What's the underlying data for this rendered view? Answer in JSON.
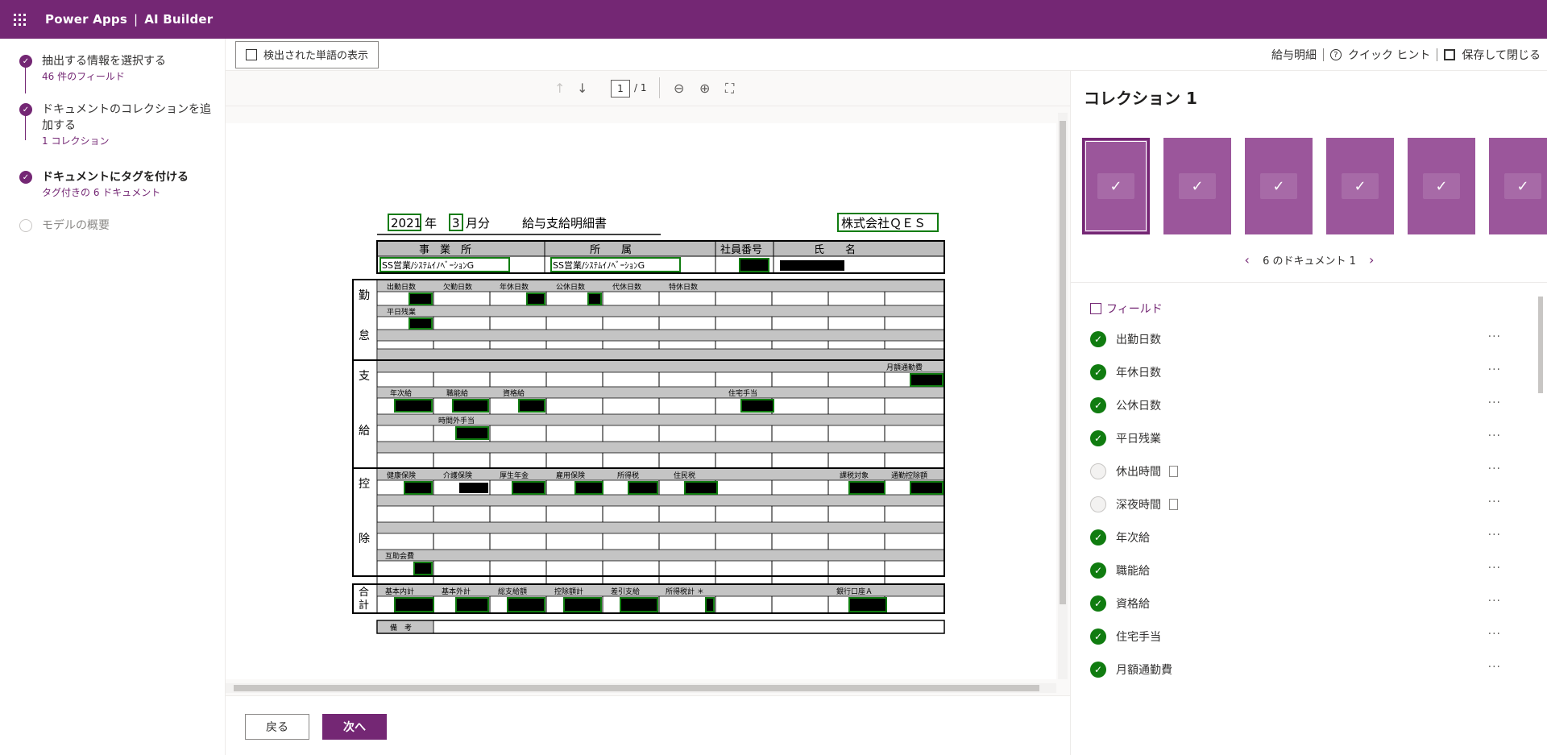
{
  "app": {
    "name": "Power Apps",
    "product": "AI Builder",
    "sep": "|"
  },
  "steps": [
    {
      "title": "抽出する情報を選択する",
      "sub": "46 件のフィールド",
      "state": "done"
    },
    {
      "title": "ドキュメントのコレクションを追加する",
      "sub": "1 コレクション",
      "state": "done"
    },
    {
      "title": "ドキュメントにタグを付ける",
      "sub": "タグ付きの 6 ドキュメント",
      "state": "current"
    },
    {
      "title": "モデルの概要",
      "sub": "",
      "state": "todo"
    }
  ],
  "toolbar": {
    "show_words": "検出された単語の表示",
    "doc_name": "給与明細",
    "quick_hint": "クイック ヒント",
    "save_close": "保存して閉じる"
  },
  "viewer": {
    "page_current": "1",
    "page_total": "/ 1"
  },
  "form": {
    "year": "2021",
    "year_unit": "年",
    "month": "3",
    "month_unit": "月分",
    "title": "給与支給明細書",
    "company": "株式会社ＱＥＳ",
    "h_office": "事　業　所",
    "h_dept": "所　　属",
    "h_empno": "社員番号",
    "h_name": "氏　　名",
    "office_val": "SS営業/ｼｽﾃﾑｲﾉﾍﾞｰｼｮﾝG",
    "dept_val": "SS営業/ｼｽﾃﾑｲﾉﾍﾞｰｼｮﾝG",
    "sec1": [
      "勤",
      "怠"
    ],
    "sec2": [
      "支",
      "給"
    ],
    "sec3": [
      "控",
      "除"
    ],
    "sec4": [
      "合",
      "計"
    ],
    "att_labels": [
      "出勤日数",
      "欠勤日数",
      "年休日数",
      "公休日数",
      "代休日数",
      "特休日数"
    ],
    "att_extra": "平日残業",
    "pay_labels": [
      "年次給",
      "職能給",
      "資格給"
    ],
    "pay_house": "住宅手当",
    "pay_commute": "月額通勤費",
    "pay_ot": "時間外手当",
    "ded_labels": [
      "健康保険",
      "介護保険",
      "厚生年金",
      "雇用保険",
      "所得税",
      "住民税"
    ],
    "ded_taxable": "課税対象",
    "ded_deduct": "通勤控除額",
    "ded_mutual": "互助会費",
    "tot_labels": [
      "基本内計",
      "基本外計",
      "総支給額",
      "控除額計",
      "差引支給",
      "所得税計 ＊"
    ],
    "tot_bank": "銀行口座Ａ",
    "remarks": "備　考"
  },
  "bottom": {
    "back": "戻る",
    "next": "次へ"
  },
  "collection": {
    "title": "コレクション 1",
    "pager": "6 のドキュメント 1",
    "prev": "‹",
    "next": "›",
    "thumb_count": 6
  },
  "fields": {
    "header": "フィールド",
    "items": [
      {
        "label": "出勤日数",
        "tagged": true
      },
      {
        "label": "年休日数",
        "tagged": true
      },
      {
        "label": "公休日数",
        "tagged": true
      },
      {
        "label": "平日残業",
        "tagged": true
      },
      {
        "label": "休出時間",
        "tagged": false
      },
      {
        "label": "深夜時間",
        "tagged": false
      },
      {
        "label": "年次給",
        "tagged": true
      },
      {
        "label": "職能給",
        "tagged": true
      },
      {
        "label": "資格給",
        "tagged": true
      },
      {
        "label": "住宅手当",
        "tagged": true
      },
      {
        "label": "月額通勤費",
        "tagged": true
      }
    ],
    "more": "···"
  },
  "colors": {
    "brand": "#742774",
    "tag_green": "#107c10",
    "check_green": "#107c10"
  }
}
